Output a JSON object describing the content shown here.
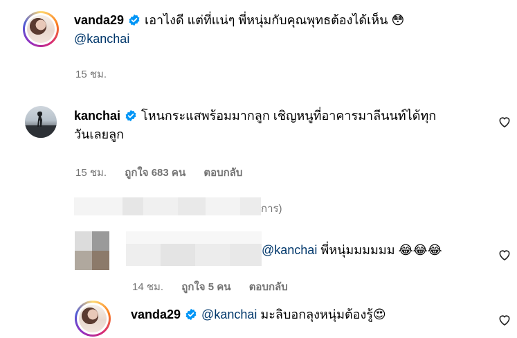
{
  "comments": [
    {
      "username": "vanda29",
      "text": "เอาไงดี แต่ที่แน่ๆ พี่หนุ่มกับคุณพุทธต้องได้เห็น",
      "emoji": "😳",
      "mention": "@kanchai",
      "time": "15 ชม."
    },
    {
      "username": "kanchai",
      "text_line1": "โหนกระแสพร้อมมากลูก เชิญหนูที่อาคารมาลีนนท์ได้ทุก",
      "text_line2": "วันเลยลูก",
      "time": "15 ชม.",
      "likes": "ถูกใจ 683 คน",
      "reply": "ตอบกลับ"
    }
  ],
  "hidden_replies_suffix": "การ)",
  "replies": [
    {
      "mention": "@kanchai",
      "text": "พี่หนุ่มมมมมม",
      "emojis": "😂😂😂",
      "time": "14 ชม.",
      "likes": "ถูกใจ 5 คน",
      "reply": "ตอบกลับ"
    },
    {
      "username": "vanda29",
      "mention": "@kanchai",
      "text": "มะลิบอกลุงหนุ่มต้องรู้",
      "emoji": "😍"
    }
  ],
  "colors": {
    "verified": "#0095f6",
    "mention": "#00376b",
    "meta": "#737373"
  }
}
